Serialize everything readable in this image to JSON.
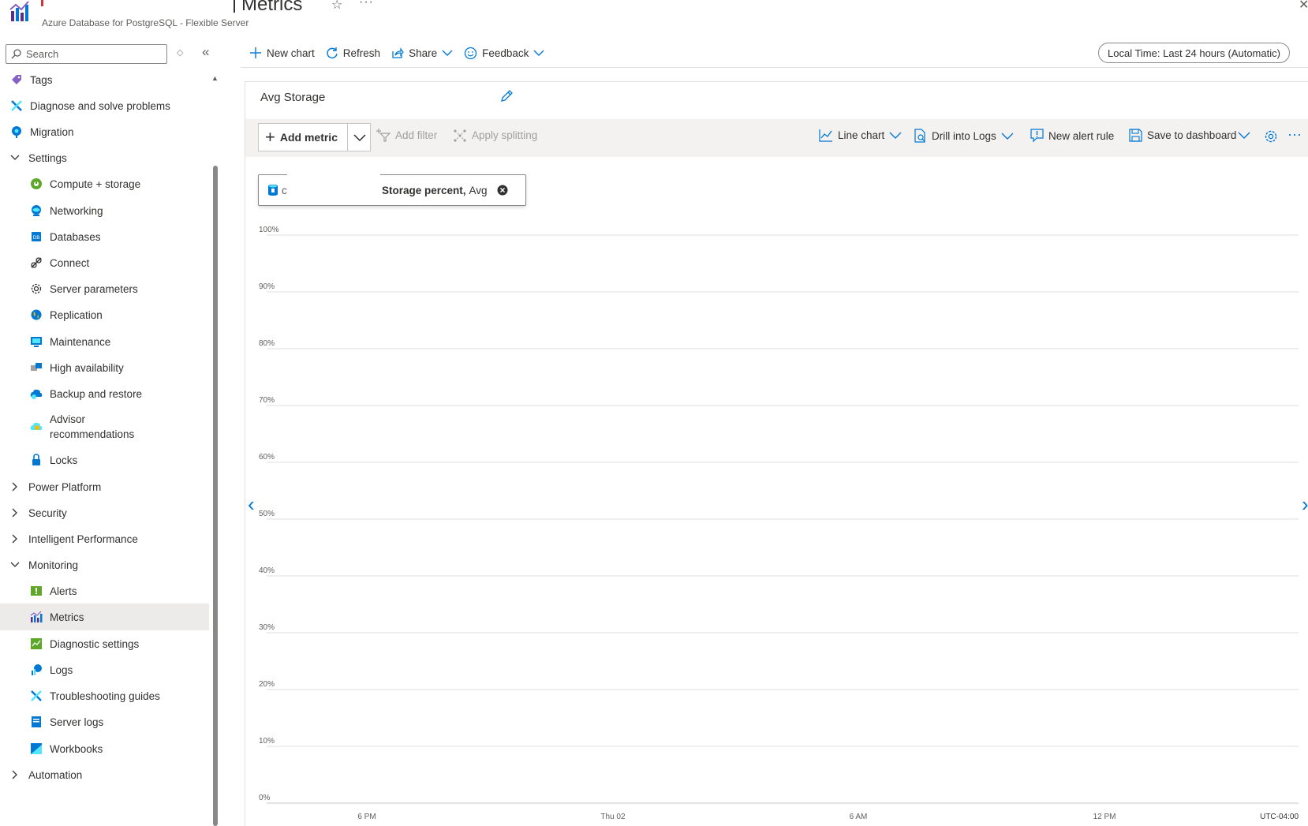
{
  "header": {
    "title": "Metrics",
    "subtitle": "Azure Database for PostgreSQL - Flexible Server"
  },
  "sidebar": {
    "search_placeholder": "Search",
    "items": [
      {
        "label": "Tags",
        "icon": "tag-icon",
        "level": 0,
        "active": false
      },
      {
        "label": "Diagnose and solve problems",
        "icon": "wrench-icon",
        "level": 0,
        "active": false
      },
      {
        "label": "Migration",
        "icon": "migration-icon",
        "level": 0,
        "active": false
      },
      {
        "label": "Settings",
        "icon": "chevron-down-icon",
        "level": 0,
        "expanded": true
      },
      {
        "label": "Compute + storage",
        "icon": "compute-icon",
        "level": 1
      },
      {
        "label": "Networking",
        "icon": "networking-icon",
        "level": 1
      },
      {
        "label": "Databases",
        "icon": "database-icon",
        "level": 1
      },
      {
        "label": "Connect",
        "icon": "connect-icon",
        "level": 1
      },
      {
        "label": "Server parameters",
        "icon": "gear-icon",
        "level": 1
      },
      {
        "label": "Replication",
        "icon": "globe-icon",
        "level": 1
      },
      {
        "label": "Maintenance",
        "icon": "maintenance-icon",
        "level": 1
      },
      {
        "label": "High availability",
        "icon": "high-availability-icon",
        "level": 1
      },
      {
        "label": "Backup and restore",
        "icon": "cloud-backup-icon",
        "level": 1
      },
      {
        "label": "Advisor\nrecommendations",
        "icon": "advisor-icon",
        "level": 1
      },
      {
        "label": "Locks",
        "icon": "lock-icon",
        "level": 1
      },
      {
        "label": "Power Platform",
        "icon": "chevron-right-icon",
        "level": 0,
        "expanded": false
      },
      {
        "label": "Security",
        "icon": "chevron-right-icon",
        "level": 0,
        "expanded": false
      },
      {
        "label": "Intelligent Performance",
        "icon": "chevron-right-icon",
        "level": 0,
        "expanded": false
      },
      {
        "label": "Monitoring",
        "icon": "chevron-down-icon",
        "level": 0,
        "expanded": true
      },
      {
        "label": "Alerts",
        "icon": "alert-icon",
        "level": 1
      },
      {
        "label": "Metrics",
        "icon": "metrics-icon",
        "level": 1,
        "active": true
      },
      {
        "label": "Diagnostic settings",
        "icon": "diagnostic-icon",
        "level": 1
      },
      {
        "label": "Logs",
        "icon": "logs-icon",
        "level": 1
      },
      {
        "label": "Troubleshooting guides",
        "icon": "wrench-icon",
        "level": 1
      },
      {
        "label": "Server logs",
        "icon": "server-logs-icon",
        "level": 1
      },
      {
        "label": "Workbooks",
        "icon": "workbooks-icon",
        "level": 1
      },
      {
        "label": "Automation",
        "icon": "chevron-right-icon",
        "level": 0,
        "expanded": false
      }
    ]
  },
  "toolbar": {
    "new_chart": "New chart",
    "refresh": "Refresh",
    "share": "Share",
    "feedback": "Feedback",
    "time_range": "Local Time: Last 24 hours (Automatic)"
  },
  "chart_card": {
    "title": "Avg Storage",
    "add_metric": "Add metric",
    "add_filter": "Add filter",
    "apply_splitting": "Apply splitting",
    "line_chart": "Line chart",
    "drill_into_logs": "Drill into Logs",
    "new_alert_rule": "New alert rule",
    "save_to_dashboard": "Save to dashboard",
    "metric_pill": {
      "resource": "c",
      "metric": "Storage percent,",
      "aggregation": "Avg"
    }
  },
  "colors": {
    "accent": "#0078d4",
    "active_nav": "#edebe9",
    "gridline": "#e1dfdd"
  },
  "chart_data": {
    "type": "line",
    "title": "",
    "y_ticks": [
      "100%",
      "90%",
      "80%",
      "70%",
      "60%",
      "50%",
      "40%",
      "30%",
      "20%",
      "10%",
      "0%"
    ],
    "ylim": [
      0,
      100
    ],
    "x_ticks": [
      "6 PM",
      "Thu 02",
      "6 AM",
      "12 PM"
    ],
    "timezone_label": "UTC-04:00",
    "series": [],
    "grid": true
  }
}
